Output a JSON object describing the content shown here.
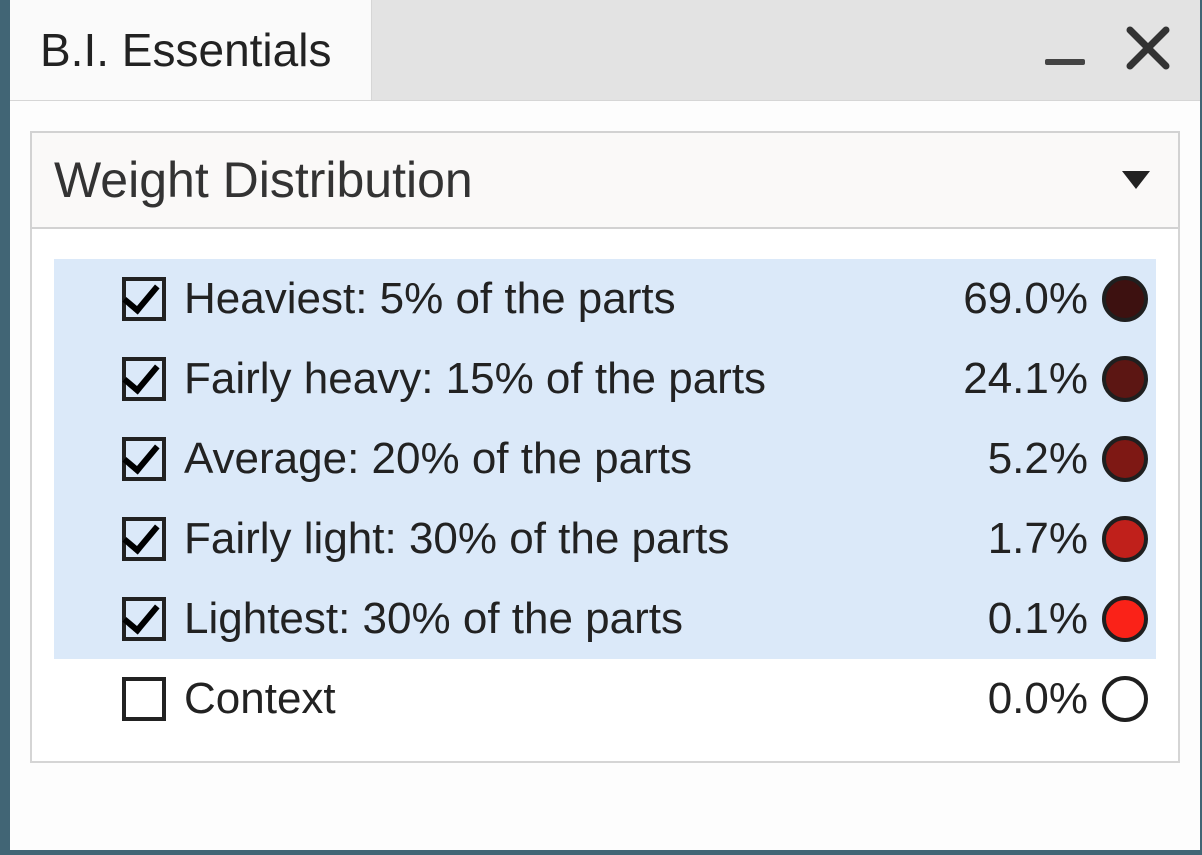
{
  "titlebar": {
    "title": "B.I. Essentials"
  },
  "dropdown": {
    "selected": "Weight Distribution"
  },
  "rows": [
    {
      "checked": true,
      "selected": true,
      "label": "Heaviest: 5% of the parts",
      "value": "69.0%",
      "color": "#3d1110"
    },
    {
      "checked": true,
      "selected": true,
      "label": "Fairly heavy: 15% of the parts",
      "value": "24.1%",
      "color": "#5c1613"
    },
    {
      "checked": true,
      "selected": true,
      "label": "Average: 20% of the parts",
      "value": "5.2%",
      "color": "#7e1814"
    },
    {
      "checked": true,
      "selected": true,
      "label": "Fairly light: 30% of the parts",
      "value": "1.7%",
      "color": "#c0201b"
    },
    {
      "checked": true,
      "selected": true,
      "label": "Lightest: 30% of the parts",
      "value": "0.1%",
      "color": "#fa2218"
    },
    {
      "checked": false,
      "selected": false,
      "label": "Context",
      "value": "0.0%",
      "color": "#ffffff"
    }
  ]
}
